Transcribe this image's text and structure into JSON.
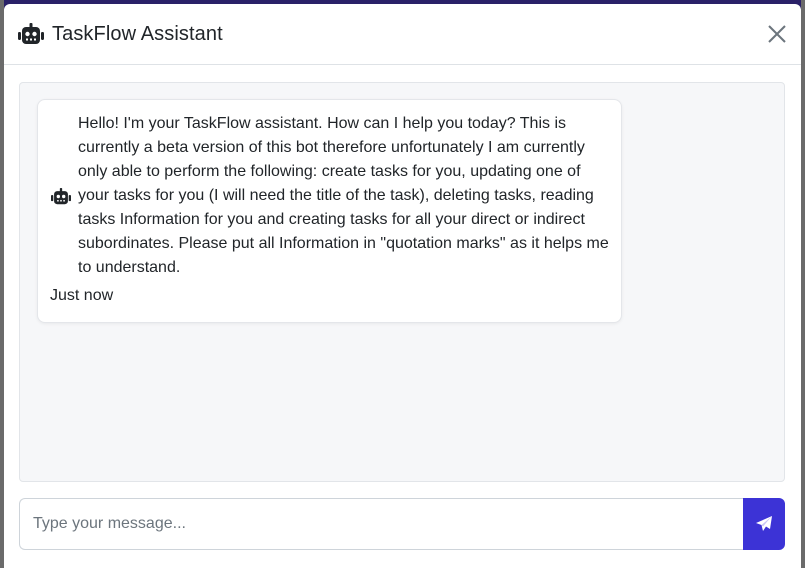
{
  "header": {
    "title": "TaskFlow Assistant",
    "icon": "robot-icon",
    "close_icon": "close-icon"
  },
  "messages": [
    {
      "sender": "bot",
      "avatar_icon": "robot-icon",
      "text": "Hello! I'm your TaskFlow assistant. How can I help you today? This is currently a beta version of this bot therefore unfortunately I am currently only able to perform the following: create tasks for you, updating one of your tasks for you (I will need the title of the task), deleting tasks, reading tasks Information for you and creating tasks for all your direct or indirect subordinates. Please put all Information in \"quotation marks\" as it helps me to understand.",
      "time": "Just now"
    }
  ],
  "composer": {
    "placeholder": "Type your message...",
    "value": "",
    "send_icon": "paper-plane-icon"
  },
  "colors": {
    "accent": "#3c33d6",
    "backdrop": "#2a2168",
    "chat_background": "#f6f7f9"
  }
}
